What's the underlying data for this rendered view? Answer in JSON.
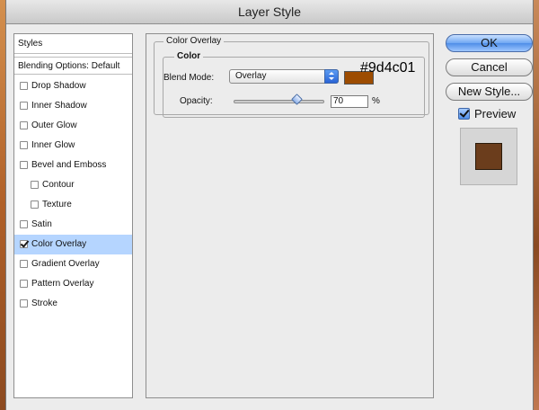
{
  "window": {
    "title": "Layer Style"
  },
  "styles_panel": {
    "header": "Styles",
    "blending_options": "Blending Options: Default",
    "items": [
      {
        "label": "Drop Shadow",
        "checked": false,
        "indent": false,
        "selected": false
      },
      {
        "label": "Inner Shadow",
        "checked": false,
        "indent": false,
        "selected": false
      },
      {
        "label": "Outer Glow",
        "checked": false,
        "indent": false,
        "selected": false
      },
      {
        "label": "Inner Glow",
        "checked": false,
        "indent": false,
        "selected": false
      },
      {
        "label": "Bevel and Emboss",
        "checked": false,
        "indent": false,
        "selected": false
      },
      {
        "label": "Contour",
        "checked": false,
        "indent": true,
        "selected": false
      },
      {
        "label": "Texture",
        "checked": false,
        "indent": true,
        "selected": false
      },
      {
        "label": "Satin",
        "checked": false,
        "indent": false,
        "selected": false
      },
      {
        "label": "Color Overlay",
        "checked": true,
        "indent": false,
        "selected": true
      },
      {
        "label": "Gradient Overlay",
        "checked": false,
        "indent": false,
        "selected": false
      },
      {
        "label": "Pattern Overlay",
        "checked": false,
        "indent": false,
        "selected": false
      },
      {
        "label": "Stroke",
        "checked": false,
        "indent": false,
        "selected": false
      }
    ]
  },
  "color_overlay": {
    "group_title": "Color Overlay",
    "subgroup_title": "Color",
    "blend_mode_label": "Blend Mode:",
    "blend_mode_value": "Overlay",
    "swatch_color": "#9d4c01",
    "opacity_label": "Opacity:",
    "opacity_value": "70",
    "opacity_unit": "%",
    "opacity_fraction": 0.7
  },
  "annotation": {
    "hex": "#9d4c01"
  },
  "buttons": {
    "ok": "OK",
    "cancel": "Cancel",
    "new_style": "New Style..."
  },
  "preview": {
    "label": "Preview",
    "checked": true,
    "swatch_color": "#6b3d1c"
  }
}
